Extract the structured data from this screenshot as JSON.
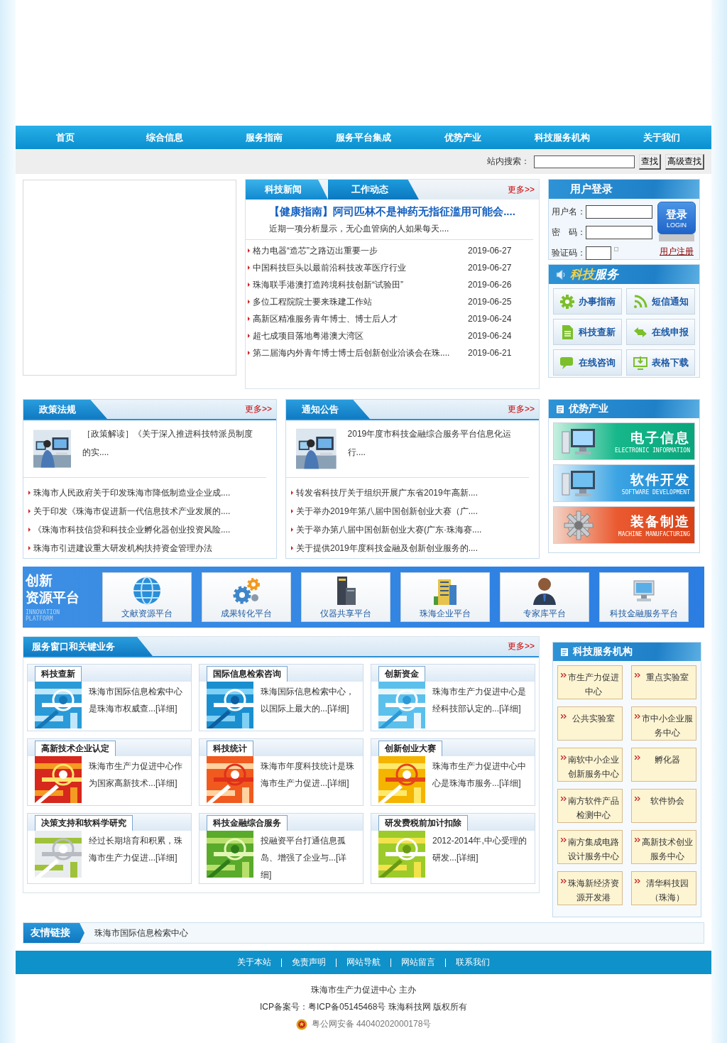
{
  "nav": [
    {
      "label": "首页"
    },
    {
      "label": "综合信息"
    },
    {
      "label": "服务指南"
    },
    {
      "label": "服务平台集成"
    },
    {
      "label": "优势产业"
    },
    {
      "label": "科技服务机构"
    },
    {
      "label": "关于我们"
    }
  ],
  "search": {
    "label": "站内搜索：",
    "buttons": [
      "查找",
      "高级查找"
    ]
  },
  "news": {
    "tabs": [
      {
        "label": "科技新闻",
        "selected": true
      },
      {
        "label": "工作动态",
        "selected": false
      }
    ],
    "more": "更多>>",
    "headline": "【健康指南】阿司匹林不是神药无指征滥用可能会....",
    "summary": "近期一项分析显示，无心血管病的人如果每天....",
    "items": [
      {
        "title": "格力电器“造芯”之路迈出重要一步",
        "date": "2019-06-27"
      },
      {
        "title": "中国科技巨头以最前沿科技改革医疗行业",
        "date": "2019-06-27"
      },
      {
        "title": "珠海联手港澳打造跨境科技创新“试验田”",
        "date": "2019-06-26"
      },
      {
        "title": "多位工程院院士要来珠建工作站",
        "date": "2019-06-25"
      },
      {
        "title": "高新区精准服务青年博士、博士后人才",
        "date": "2019-06-24"
      },
      {
        "title": "超七成项目落地粤港澳大湾区",
        "date": "2019-06-24"
      },
      {
        "title": "第二届海内外青年博士博士后创新创业洽谈会在珠....",
        "date": "2019-06-21"
      }
    ]
  },
  "login": {
    "title": "用户登录",
    "fields": [
      {
        "label": "用户名："
      },
      {
        "label": "密　码："
      },
      {
        "label": "验证码："
      }
    ],
    "button": "登录",
    "button_sub": "LOGIN",
    "register": "用户注册"
  },
  "services": {
    "title_a": "科技",
    "title_b": "服务",
    "items": [
      {
        "label": "办事指南",
        "kind": "gear"
      },
      {
        "label": "短信通知",
        "kind": "rss"
      },
      {
        "label": "科技查新",
        "kind": "doc"
      },
      {
        "label": "在线申报",
        "kind": "swap"
      },
      {
        "label": "在线咨询",
        "kind": "chat"
      },
      {
        "label": "表格下载",
        "kind": "download"
      }
    ]
  },
  "columns": [
    {
      "title": "政策法规",
      "more": "更多>>",
      "feature": {
        "kind": "picture",
        "text": "［政策解读］《关于深入推进科技特派员制度的实...."
      },
      "items": [
        "珠海市人民政府关于印发珠海市降低制造业企业成....",
        "关于印发《珠海市促进新一代信息技术产业发展的....",
        "《珠海市科技信贷和科技企业孵化器创业投资风险....",
        "珠海市引进建设重大研发机构扶持资金管理办法"
      ]
    },
    {
      "title": "通知公告",
      "more": "更多>>",
      "feature": {
        "kind": "picture",
        "text": "2019年度市科技金融综合服务平台信息化运行...."
      },
      "items": [
        "转发省科技厅关于组织开展广东省2019年高新....",
        "关于举办2019年第八届中国创新创业大赛（广....",
        "关于举办第八届中国创新创业大赛(广东·珠海赛....",
        "关于提供2019年度科技金融及创新创业服务的...."
      ]
    }
  ],
  "industry": {
    "title": "优势产业",
    "items": [
      {
        "title": "电子信息",
        "subtitle": "ELECTRONIC INFORMATION",
        "kind": "green"
      },
      {
        "title": "软件开发",
        "subtitle": "SOFTWARE DEVELOPMENT",
        "kind": "blue"
      },
      {
        "title": "装备制造",
        "subtitle": "MACHINE MANUFACTURING",
        "kind": "red"
      }
    ]
  },
  "platform": {
    "title_1": "创新",
    "title_2": "资源平台",
    "subtitle_1": "INNOVATION",
    "subtitle_2": "PLATFORM",
    "items": [
      {
        "label": "文献资源平台",
        "kind": "globe"
      },
      {
        "label": "成果转化平台",
        "kind": "gears"
      },
      {
        "label": "仪器共享平台",
        "kind": "server"
      },
      {
        "label": "珠海企业平台",
        "kind": "building"
      },
      {
        "label": "专家库平台",
        "kind": "person"
      },
      {
        "label": "科技金融服务平台",
        "kind": "monitor"
      }
    ]
  },
  "service_window": {
    "title": "服务窗口和关键业务",
    "more": "更多>>",
    "cards": [
      {
        "title": "科技查新",
        "text": "珠海市国际信息检索中心是珠海市权威查...[详细]",
        "kind": "picture"
      },
      {
        "title": "国际信息检索咨询",
        "text": "珠海国际信息检索中心，以国际上最大的...[详细]",
        "kind": "picture"
      },
      {
        "title": "创新资金",
        "text": "珠海市生产力促进中心是经科技部认定的...[详细]",
        "kind": "picture"
      },
      {
        "title": "高新技术企业认定",
        "text": "珠海市生产力促进中心作为国家高新技术...[详细]",
        "kind": "picture"
      },
      {
        "title": "科技统计",
        "text": "珠海市年度科技统计是珠海市生产力促进...[详细]",
        "kind": "picture"
      },
      {
        "title": "创新创业大赛",
        "text": "珠海市生产力促进中心中心是珠海市服务...[详细]",
        "kind": "picture"
      },
      {
        "title": "决策支持和软科学研究",
        "text": "经过长期培育和积累，珠海市生产力促进...[详细]",
        "kind": "picture"
      },
      {
        "title": "科技金融综合服务",
        "text": "投融资平台打通信息孤岛、增强了企业与...[详细]",
        "kind": "picture"
      },
      {
        "title": "研发费税前加计扣除",
        "text": "2012-2014年,中心受理的研发...[详细]",
        "kind": "picture"
      }
    ]
  },
  "institutions": {
    "title": "科技服务机构",
    "items": [
      "市生产力促进中心",
      "重点实验室",
      "公共实验室",
      "市中小企业服务中心",
      "南软中小企业创新服务中心",
      "孵化器",
      "南方软件产品检测中心",
      "软件协会",
      "南方集成电路设计服务中心",
      "高新技术创业服务中心",
      "珠海新经济资源开发港",
      "清华科技园（珠海）"
    ]
  },
  "friend_links": {
    "title": "友情链接",
    "items": [
      "珠海市国际信息检索中心"
    ]
  },
  "footer": {
    "links": [
      "关于本站",
      "免责声明",
      "网站导航",
      "网站留言",
      "联系我们"
    ],
    "sponsor": "珠海市生产力促进中心 主办",
    "icp": "ICP备案号：粤ICP备05145468号 珠海科技网 版权所有",
    "police": "粤公网安备 44040202000178号"
  }
}
